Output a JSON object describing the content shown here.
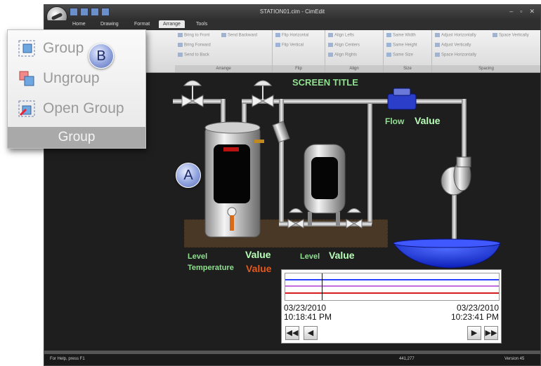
{
  "window": {
    "title": "STATION01.cim - CimEdit"
  },
  "ribbon_tabs": [
    "Home",
    "Drawing",
    "Format",
    "Arrange",
    "Tools"
  ],
  "active_tab": "Arrange",
  "ribbon": {
    "order": {
      "bring_front": "Bring to Front",
      "send_backward": "Send Backward",
      "bring_forward": "Bring Forward",
      "send_back": "Send to Back",
      "caption": "Arrange"
    },
    "flip": {
      "horizontal": "Flip Horizontal",
      "vertical": "Flip Vertical",
      "caption": "Flip"
    },
    "align": {
      "lefts": "Align Lefts",
      "centers": "Align Centers",
      "rights": "Align Rights",
      "caption": "Align"
    },
    "size": {
      "width": "Same Width",
      "height": "Same Height",
      "size": "Same Size",
      "caption": "Size"
    },
    "spacing": {
      "adj_h": "Adjust Horizontally",
      "adj_v": "Adjust Vertically",
      "space_h": "Space Horizontally",
      "space_v": "Space Vertically",
      "caption": "Spacing"
    }
  },
  "popup": {
    "group": "Group",
    "ungroup": "Ungroup",
    "open_group": "Open Group",
    "caption": "Group"
  },
  "markers": {
    "a": "A",
    "b": "B"
  },
  "screen": {
    "title": "SCREEN TITLE",
    "flow_label": "Flow",
    "flow_value": "Value",
    "level_label": "Level",
    "level_value": "Value",
    "temp_label": "Temperature",
    "temp_value": "Value",
    "level2_label": "Level",
    "level2_value": "Value"
  },
  "trend": {
    "start_date": "03/23/2010",
    "start_time": "10:18:41 PM",
    "end_date": "03/23/2010",
    "end_time": "10:23:41 PM",
    "nav": {
      "first": "◀◀",
      "prev": "◀",
      "next": "▶",
      "last": "▶▶"
    },
    "line_colors": [
      "#d61c1c",
      "#c46be0",
      "#2a40ff"
    ]
  },
  "status": {
    "help": "For Help, press F1",
    "coords": "441,277",
    "version": "Version 45"
  },
  "colors": {
    "label_green": "#8fe08f",
    "value_green": "#b8ffb8",
    "value_orange": "#e4571b",
    "basin_blue": "#1a2fe0"
  }
}
